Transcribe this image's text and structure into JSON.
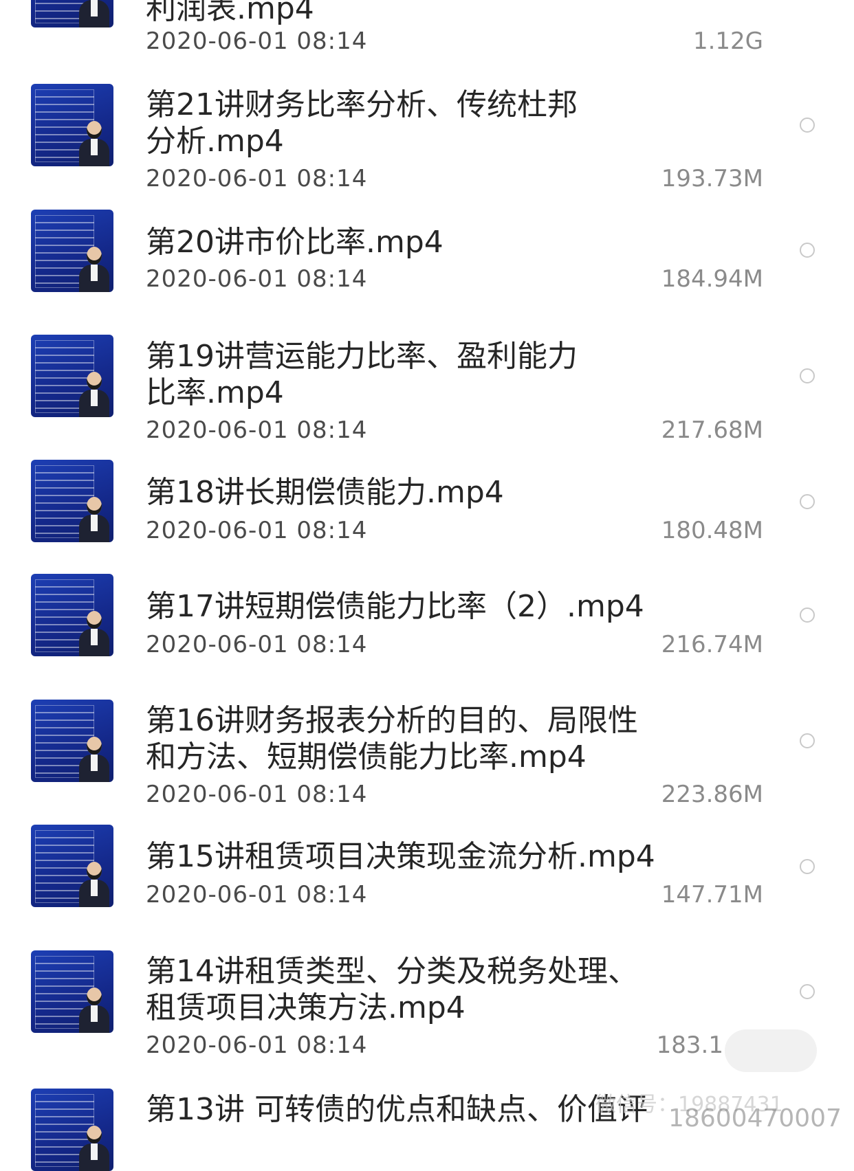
{
  "files": [
    {
      "title_lines": [
        "利润表.mp4"
      ],
      "date": "2020-06-01 08:14",
      "size": "1.12G",
      "selected": false
    },
    {
      "title_lines": [
        "第21讲财务比率分析、传统杜邦",
        "分析.mp4"
      ],
      "date": "2020-06-01 08:14",
      "size": "193.73M",
      "selected": false
    },
    {
      "title_lines": [
        "第20讲市价比率.mp4"
      ],
      "date": "2020-06-01 08:14",
      "size": "184.94M",
      "selected": false
    },
    {
      "title_lines": [
        "第19讲营运能力比率、盈利能力",
        "比率.mp4"
      ],
      "date": "2020-06-01 08:14",
      "size": "217.68M",
      "selected": false
    },
    {
      "title_lines": [
        "第18讲长期偿债能力.mp4"
      ],
      "date": "2020-06-01 08:14",
      "size": "180.48M",
      "selected": false
    },
    {
      "title_lines": [
        "第17讲短期偿债能力比率（2）.mp4"
      ],
      "date": "2020-06-01 08:14",
      "size": "216.74M",
      "selected": false
    },
    {
      "title_lines": [
        "第16讲财务报表分析的目的、局限性",
        "和方法、短期偿债能力比率.mp4"
      ],
      "date": "2020-06-01 08:14",
      "size": "223.86M",
      "selected": false
    },
    {
      "title_lines": [
        "第15讲租赁项目决策现金流分析.mp4"
      ],
      "date": "2020-06-01 08:14",
      "size": "147.71M",
      "selected": false
    },
    {
      "title_lines": [
        "第14讲租赁类型、分类及税务处理、",
        "租赁项目决策方法.mp4"
      ],
      "date": "2020-06-01 08:14",
      "size": "183.1",
      "selected": false
    },
    {
      "title_lines": [
        "第13讲 可转债的优点和缺点、价值评"
      ],
      "date": "",
      "size": "",
      "selected": false
    }
  ],
  "watermark": {
    "id_text": "微信号：19887431",
    "phone_text": "18600470007"
  }
}
